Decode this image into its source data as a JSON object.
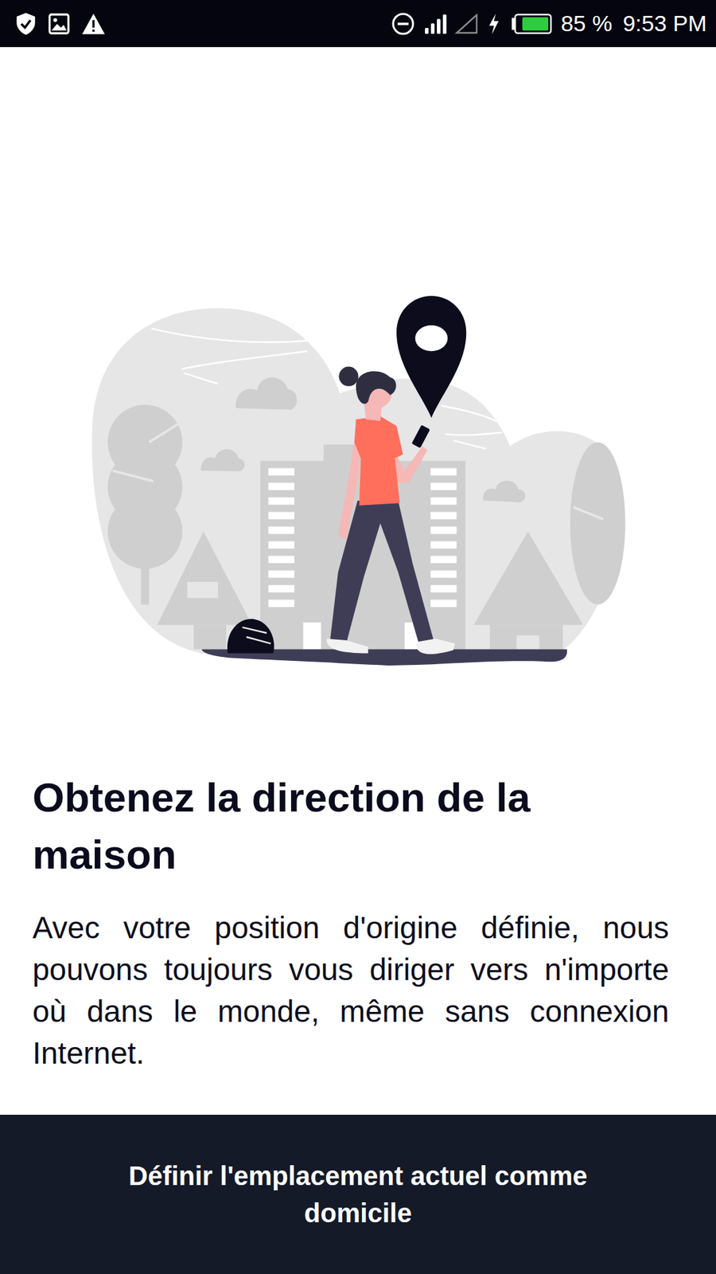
{
  "status_bar": {
    "do_not_disturb": true,
    "signals": [
      {
        "level": 1
      },
      {
        "level": 0
      }
    ],
    "battery": {
      "reading": "85 %",
      "level": 0.85,
      "charging": true
    },
    "time": "9:53 PM"
  },
  "onboarding": {
    "title": "Obtenez la direction de la maison",
    "description": "Avec votre position d'origine définie, nous pouvons toujours vous diriger vers n'importe où dans le monde, même sans connexion Internet.",
    "button": "Définir l'emplacement actuel comme domicile"
  }
}
